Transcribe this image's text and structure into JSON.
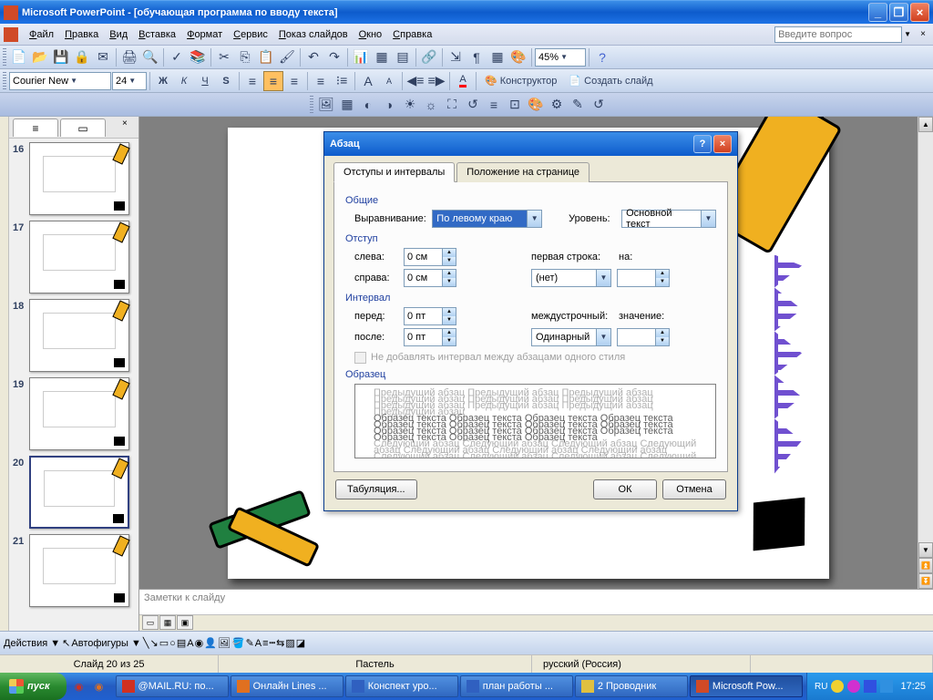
{
  "titlebar": {
    "app": "Microsoft PowerPoint",
    "doc": "[обучающая программа по вводу текста]"
  },
  "menubar": {
    "items": [
      "Файл",
      "Правка",
      "Вид",
      "Вставка",
      "Формат",
      "Сервис",
      "Показ слайдов",
      "Окно",
      "Справка"
    ],
    "search_placeholder": "Введите вопрос"
  },
  "format_toolbar": {
    "font": "Courier New",
    "size": "24",
    "designer": "Конструктор",
    "new_slide": "Создать слайд"
  },
  "zoom": "45%",
  "thumbs": {
    "start": 16,
    "selected": 20,
    "count": 6
  },
  "notes": {
    "placeholder": "Заметки к слайду"
  },
  "dialog": {
    "title": "Абзац",
    "tabs": [
      "Отступы и интервалы",
      "Положение на странице"
    ],
    "groups": {
      "general": "Общие",
      "indent": "Отступ",
      "spacing": "Интервал",
      "sample": "Образец"
    },
    "labels": {
      "alignment": "Выравнивание:",
      "level": "Уровень:",
      "left": "слева:",
      "right": "справа:",
      "first_line": "первая строка:",
      "by": "на:",
      "before": "перед:",
      "after": "после:",
      "line_spacing": "междустрочный:",
      "at": "значение:"
    },
    "values": {
      "alignment": "По левому краю",
      "level": "Основной текст",
      "left": "0 см",
      "right": "0 см",
      "first_line": "(нет)",
      "before": "0 пт",
      "after": "0 пт",
      "line_spacing": "Одинарный"
    },
    "checkbox": "Не добавлять интервал между абзацами одного стиля",
    "sample_prev": "Предыдущий абзац Предыдущий абзац Предыдущий абзац Предыдущий абзац Предыдущий абзац Предыдущий абзац Предыдущий абзац Предыдущий абзац Предыдущий абзац Предыдущий абзац",
    "sample_cur": "Образец текста Образец текста Образец текста Образец текста Образец текста Образец текста Образец текста Образец текста Образец текста Образец текста Образец текста Образец текста Образец текста Образец текста Образец текста",
    "sample_next": "Следующий абзац Следующий абзац Следующий абзац Следующий абзац Следующий абзац Следующий абзац Следующий абзац Следующий абзац Следующий абзац Следующий абзац Следующий абзац Следующий абзац Следующий абзац Следующий абзац Следующий абзац Следующий абзац Следующий абзац Следующий абзац",
    "buttons": {
      "tabs": "Табуляция...",
      "ok": "ОК",
      "cancel": "Отмена"
    }
  },
  "draw_toolbar": {
    "actions": "Действия",
    "autoshapes": "Автофигуры"
  },
  "statusbar": {
    "slide": "Слайд 20 из 25",
    "theme": "Пастель",
    "lang": "русский (Россия)"
  },
  "taskbar": {
    "start": "пуск",
    "tasks": [
      {
        "label": "@MAIL.RU: по...",
        "icon": "#d03020"
      },
      {
        "label": "Онлайн Lines ...",
        "icon": "#e07020"
      },
      {
        "label": "Конспект уро...",
        "icon": "#3060c0"
      },
      {
        "label": "план работы ...",
        "icon": "#3060c0"
      },
      {
        "label": "2 Проводник",
        "icon": "#e0c040"
      },
      {
        "label": "Microsoft Pow...",
        "icon": "#d04a27",
        "active": true
      }
    ],
    "lang": "RU",
    "time": "17:25"
  }
}
